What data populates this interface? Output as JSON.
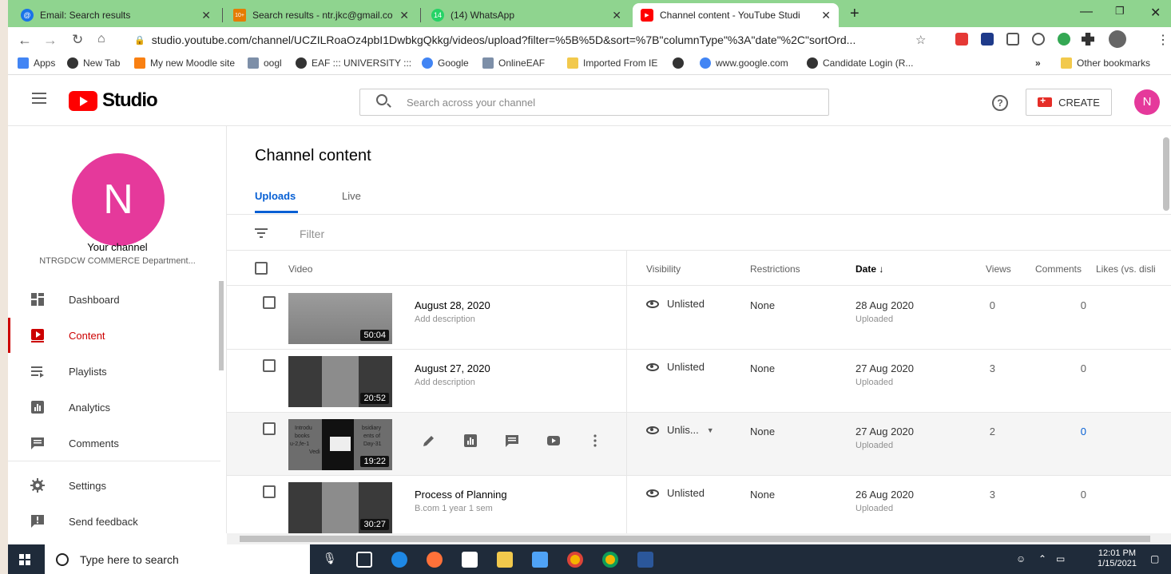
{
  "browser": {
    "tabs": [
      {
        "title": "Email: Search results",
        "color": "#1a73e8",
        "glyph": "@"
      },
      {
        "title": "Search results - ntr.jkc@gmail.co",
        "color": "#e57c00",
        "glyph": "10+"
      },
      {
        "title": "(14) WhatsApp",
        "color": "#25d366",
        "glyph": "14"
      },
      {
        "title": "Channel content - YouTube Studi",
        "color": "#ff0000",
        "glyph": "▶"
      }
    ],
    "new_tab": "+",
    "url": "studio.youtube.com/channel/UCZILRoaOz4pbI1DwbkgQkkg/videos/upload?filter=%5B%5D&sort=%7B\"columnType\"%3A\"date\"%2C\"sortOrd...",
    "bookmarks": [
      {
        "label": "Apps",
        "color": "#4285f4"
      },
      {
        "label": "New Tab",
        "color": "#333333"
      },
      {
        "label": "My new Moodle site",
        "color": "#f98012"
      },
      {
        "label": "oogl",
        "color": "#7d8fa8"
      },
      {
        "label": "EAF ::: UNIVERSITY :::",
        "color": "#333333"
      },
      {
        "label": "Google",
        "color": "#4285f4"
      },
      {
        "label": "OnlineEAF",
        "color": "#7d8fa8"
      },
      {
        "label": "Imported From IE",
        "color": "#f2c94c"
      },
      {
        "label": "",
        "color": "#333333"
      },
      {
        "label": "www.google.com",
        "color": "#4285f4"
      },
      {
        "label": "Candidate Login (R...",
        "color": "#333333"
      }
    ],
    "bookmarks_overflow": "»",
    "other_bookmarks": "Other bookmarks"
  },
  "studio": {
    "logo_text": "Studio",
    "search_placeholder": "Search across your channel",
    "help": "?",
    "create_label": "CREATE",
    "avatar_letter": "N",
    "accent": "#e5399b"
  },
  "sidebar": {
    "avatar_letter": "N",
    "your_channel": "Your channel",
    "channel_name": "NTRGDCW COMMERCE Department...",
    "items": [
      {
        "label": "Dashboard",
        "icon": "dashboard-icon"
      },
      {
        "label": "Content",
        "icon": "content-icon",
        "active": true
      },
      {
        "label": "Playlists",
        "icon": "playlists-icon"
      },
      {
        "label": "Analytics",
        "icon": "analytics-icon"
      },
      {
        "label": "Comments",
        "icon": "comments-icon"
      },
      {
        "label": "Settings",
        "icon": "settings-icon"
      },
      {
        "label": "Send feedback",
        "icon": "feedback-icon"
      }
    ]
  },
  "main": {
    "title": "Channel content",
    "tabs": [
      "Uploads",
      "Live"
    ],
    "filter_placeholder": "Filter",
    "columns": {
      "video": "Video",
      "visibility": "Visibility",
      "restrictions": "Restrictions",
      "date": "Date ↓",
      "views": "Views",
      "comments": "Comments",
      "likes": "Likes (vs. disli"
    },
    "rows": [
      {
        "title": "August 28, 2020",
        "description": "Add description",
        "duration": "50:04",
        "visibility": "Unlisted",
        "restrictions": "None",
        "date": "28 Aug 2020",
        "status": "Uploaded",
        "views": "0",
        "comments": "0"
      },
      {
        "title": "August 27, 2020",
        "description": "Add description",
        "duration": "20:52",
        "visibility": "Unlisted",
        "restrictions": "None",
        "date": "27 Aug 2020",
        "status": "Uploaded",
        "views": "3",
        "comments": "0"
      },
      {
        "title": "",
        "description": "",
        "duration": "19:22",
        "visibility": "Unlis...",
        "restrictions": "None",
        "date": "27 Aug 2020",
        "status": "Uploaded",
        "views": "2",
        "comments": "0",
        "hover": true
      },
      {
        "title": "Process of Planning",
        "description": "B.com 1 year 1 sem",
        "duration": "30:27",
        "visibility": "Unlisted",
        "restrictions": "None",
        "date": "26 Aug 2020",
        "status": "Uploaded",
        "views": "3",
        "comments": "0"
      }
    ],
    "thumb3_text": [
      "Introdu",
      "books",
      "u-2,fe-1",
      "Vedi",
      "bsidiary",
      "ents of",
      "Day-31"
    ]
  },
  "taskbar": {
    "search_placeholder": "Type here to search",
    "time": "12:01 PM",
    "date": "1/15/2021"
  }
}
